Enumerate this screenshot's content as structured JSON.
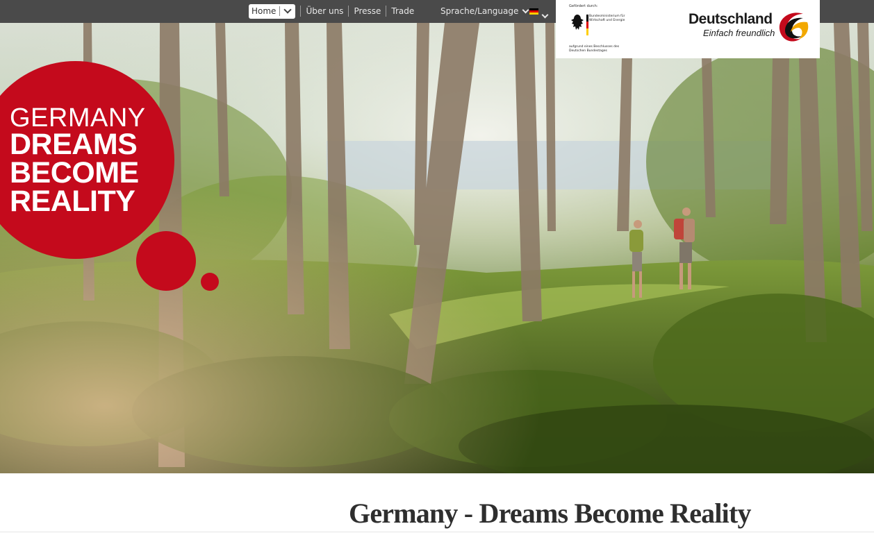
{
  "nav": {
    "home_label": "Home",
    "links": [
      "Über uns",
      "Presse",
      "Trade"
    ],
    "language_label": "Sprache/Language"
  },
  "logo": {
    "funded_label": "Gefördert durch:",
    "ministry": "Bundesministerium für Wirtschaft und Energie",
    "decision": "aufgrund eines Beschlusses des Deutschen Bundestages",
    "brand_name": "Deutschland",
    "brand_tagline": "Einfach freundlich"
  },
  "hero": {
    "headline_line1": "GERMANY",
    "headline_line2": "DREAMS BECOME REALITY"
  },
  "page_title": "Germany - Dreams Become Reality",
  "colors": {
    "topbar": "#4a4a4a",
    "brand_red": "#c40a1c",
    "flag_black": "#000000",
    "flag_red": "#dd0000",
    "flag_gold": "#ffce00"
  }
}
